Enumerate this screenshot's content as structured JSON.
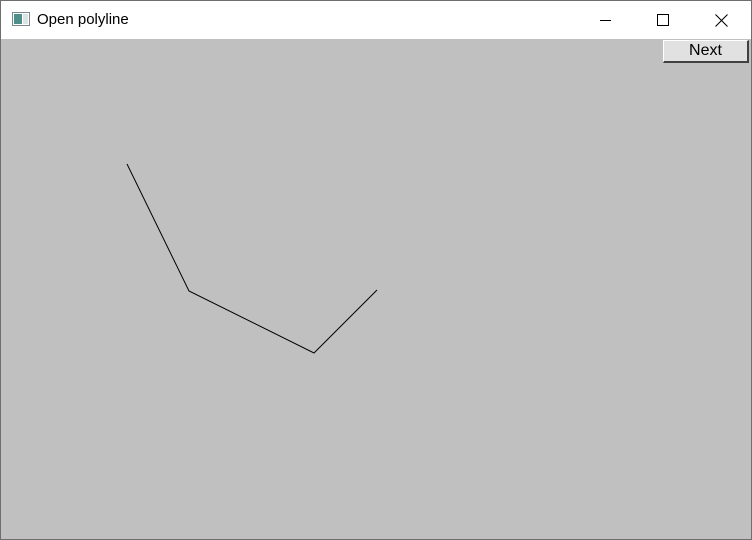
{
  "window": {
    "title": "Open polyline",
    "app_icon": "window-app-icon",
    "controls": {
      "minimize_icon": "minimize-icon",
      "maximize_icon": "maximize-icon",
      "close_icon": "close-icon"
    }
  },
  "toolbar": {
    "next_label": "Next"
  },
  "colors": {
    "client_background": "#c0c0c0",
    "titlebar_background": "#ffffff",
    "polyline_stroke": "#000000"
  }
}
